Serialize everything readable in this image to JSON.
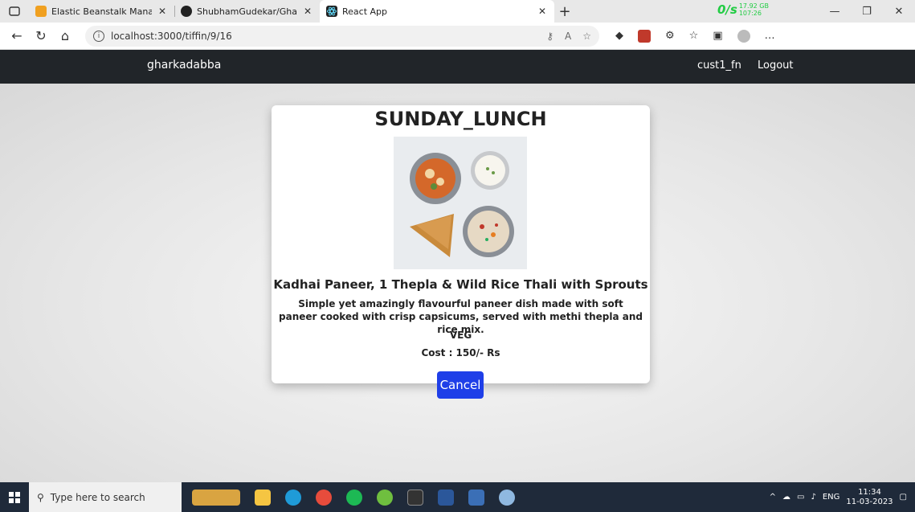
{
  "browser": {
    "tabs": [
      {
        "title": "Elastic Beanstalk Management C",
        "favicon": "aws-icon",
        "active": false
      },
      {
        "title": "ShubhamGudekar/Ghar-Ka-Dabl",
        "favicon": "github-icon",
        "active": false
      },
      {
        "title": "React App",
        "favicon": "react-icon",
        "active": true
      }
    ],
    "speed_label": "0/s",
    "speed_detail_1": "17.92 GB",
    "speed_detail_2": "107:26",
    "url": "localhost:3000/tiffin/9/16"
  },
  "navbar": {
    "brand": "gharkadabba",
    "user": "cust1_fn",
    "logout": "Logout"
  },
  "card": {
    "title": "SUNDAY_LUNCH",
    "dish_name": "Kadhai Paneer, 1 Thepla & Wild Rice Thali with Sprouts",
    "description": "Simple yet amazingly flavourful paneer dish made with soft paneer cooked with crisp capsicums, served with methi thepla and rice mix.",
    "type": "VEG",
    "cost": "Cost : 150/- Rs",
    "cancel_label": "Cancel"
  },
  "taskbar": {
    "search_placeholder": "Type here to search",
    "lang": "ENG",
    "time": "11:34",
    "date": "11-03-2023"
  },
  "colors": {
    "navbar_bg": "#212529",
    "button_bg": "#1f3fe8",
    "speed_green": "#22cc44"
  }
}
